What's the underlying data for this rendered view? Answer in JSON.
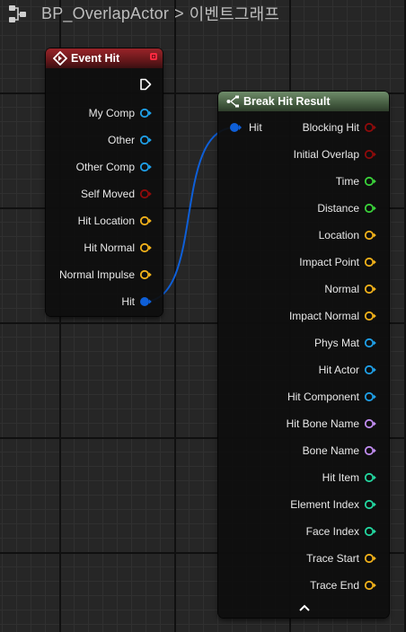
{
  "breadcrumb": {
    "items": [
      "BP_OverlapActor",
      "이벤트그래프"
    ],
    "separator": ">",
    "icon": "graph-icon"
  },
  "event_node": {
    "title": "Event Hit",
    "header_color": "#8c2227",
    "outputs": [
      {
        "label": "My Comp",
        "color": "#1fa0e8",
        "icon": "object-pin"
      },
      {
        "label": "Other",
        "color": "#1fa0e8",
        "icon": "object-pin"
      },
      {
        "label": "Other Comp",
        "color": "#1fa0e8",
        "icon": "object-pin"
      },
      {
        "label": "Self Moved",
        "color": "#8e0b0b",
        "icon": "bool-pin"
      },
      {
        "label": "Hit Location",
        "color": "#f2b21a",
        "icon": "vector-pin"
      },
      {
        "label": "Hit Normal",
        "color": "#f2b21a",
        "icon": "vector-pin"
      },
      {
        "label": "Normal Impulse",
        "color": "#f2b21a",
        "icon": "vector-pin"
      },
      {
        "label": "Hit",
        "color": "#0e5fd8",
        "icon": "struct-pin-connected"
      }
    ]
  },
  "break_node": {
    "title": "Break Hit Result",
    "header_color": "#4f6a4b",
    "input": {
      "label": "Hit",
      "color": "#0e5fd8"
    },
    "outputs": [
      {
        "label": "Blocking Hit",
        "color": "#8e0b0b"
      },
      {
        "label": "Initial Overlap",
        "color": "#8e0b0b"
      },
      {
        "label": "Time",
        "color": "#3ad23a"
      },
      {
        "label": "Distance",
        "color": "#3ad23a"
      },
      {
        "label": "Location",
        "color": "#f2b21a"
      },
      {
        "label": "Impact Point",
        "color": "#f2b21a"
      },
      {
        "label": "Normal",
        "color": "#f2b21a"
      },
      {
        "label": "Impact Normal",
        "color": "#f2b21a"
      },
      {
        "label": "Phys Mat",
        "color": "#1fa0e8"
      },
      {
        "label": "Hit Actor",
        "color": "#1fa0e8"
      },
      {
        "label": "Hit Component",
        "color": "#1fa0e8"
      },
      {
        "label": "Hit Bone Name",
        "color": "#c08cf0"
      },
      {
        "label": "Bone Name",
        "color": "#c08cf0"
      },
      {
        "label": "Hit Item",
        "color": "#23d7a0"
      },
      {
        "label": "Element Index",
        "color": "#23d7a0"
      },
      {
        "label": "Face Index",
        "color": "#23d7a0"
      },
      {
        "label": "Trace Start",
        "color": "#f2b21a"
      },
      {
        "label": "Trace End",
        "color": "#f2b21a"
      }
    ]
  },
  "wire_color": "#0e5fd8"
}
